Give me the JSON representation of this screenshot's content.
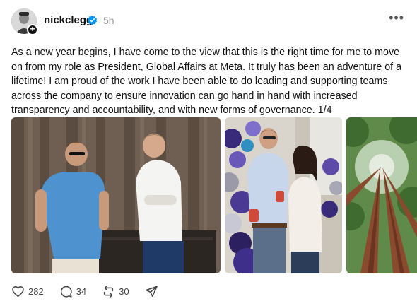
{
  "post": {
    "username": "nickclegg",
    "time": "5h",
    "text": "As a new year begins, I have come to the view that this is the right time for me to move on from my role as President, Global Affairs at Meta. It truly has been an adventure of a lifetime! I am proud of the work I have been able to do leading and supporting teams across the company to ensure innovation can go hand in hand with increased transparency and accountability, and with new forms of governance. 1/4"
  },
  "actions": {
    "likes": "282",
    "replies": "34",
    "reposts": "30"
  },
  "icons": {
    "verified": "verified-badge-icon",
    "more": "more-options-icon",
    "like": "heart-icon",
    "reply": "comment-icon",
    "repost": "repost-icon",
    "share": "send-icon"
  },
  "colors": {
    "verified_blue": "#0095f6",
    "text": "#101010",
    "muted": "#999999"
  }
}
